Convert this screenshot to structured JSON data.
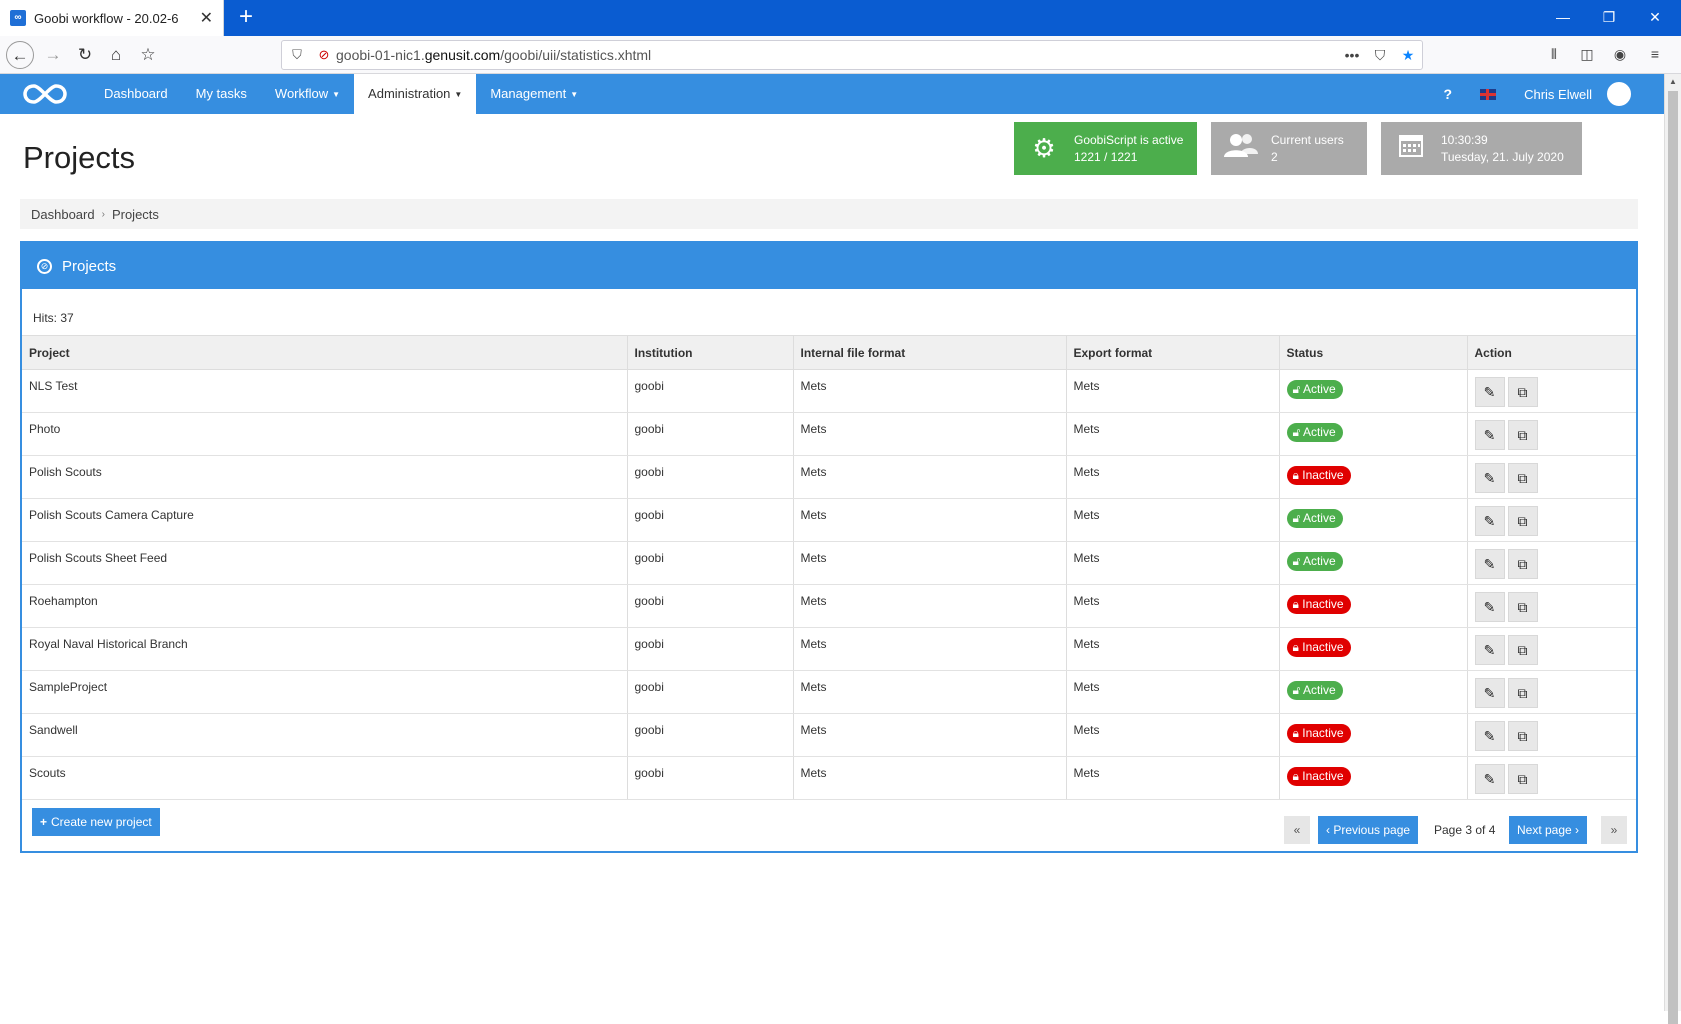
{
  "browser": {
    "tab_title": "Goobi workflow - 20.02-6",
    "url_prefix": "goobi-01-nic1.",
    "url_domain": "genusit.com",
    "url_path": "/goobi/uii/statistics.xhtml"
  },
  "nav": {
    "items": [
      {
        "label": "Dashboard",
        "dropdown": false
      },
      {
        "label": "My tasks",
        "dropdown": false
      },
      {
        "label": "Workflow",
        "dropdown": true
      },
      {
        "label": "Administration",
        "dropdown": true
      },
      {
        "label": "Management",
        "dropdown": true
      }
    ],
    "active": "Administration",
    "help": "?",
    "user": "Chris Elwell"
  },
  "header": {
    "title": "Projects",
    "goobiscript": {
      "line1": "GoobiScript is active",
      "line2": "1221 / 1221"
    },
    "users": {
      "line1": "Current users",
      "line2": "2"
    },
    "datetime": {
      "line1": "10:30:39",
      "line2": "Tuesday, 21. July 2020"
    }
  },
  "breadcrumb": [
    "Dashboard",
    "Projects"
  ],
  "box": {
    "title": "Projects",
    "hits": "Hits: 37",
    "columns": [
      "Project",
      "Institution",
      "Internal file format",
      "Export format",
      "Status",
      "Action"
    ],
    "rows": [
      {
        "project": "NLS Test",
        "institution": "goobi",
        "internal": "Mets",
        "export": "Mets",
        "status": "Active"
      },
      {
        "project": "Photo",
        "institution": "goobi",
        "internal": "Mets",
        "export": "Mets",
        "status": "Active"
      },
      {
        "project": "Polish Scouts",
        "institution": "goobi",
        "internal": "Mets",
        "export": "Mets",
        "status": "Inactive"
      },
      {
        "project": "Polish Scouts Camera Capture",
        "institution": "goobi",
        "internal": "Mets",
        "export": "Mets",
        "status": "Active"
      },
      {
        "project": "Polish Scouts Sheet Feed",
        "institution": "goobi",
        "internal": "Mets",
        "export": "Mets",
        "status": "Active"
      },
      {
        "project": "Roehampton",
        "institution": "goobi",
        "internal": "Mets",
        "export": "Mets",
        "status": "Inactive"
      },
      {
        "project": "Royal Naval Historical Branch",
        "institution": "goobi",
        "internal": "Mets",
        "export": "Mets",
        "status": "Inactive"
      },
      {
        "project": "SampleProject",
        "institution": "goobi",
        "internal": "Mets",
        "export": "Mets",
        "status": "Active"
      },
      {
        "project": "Sandwell",
        "institution": "goobi",
        "internal": "Mets",
        "export": "Mets",
        "status": "Inactive"
      },
      {
        "project": "Scouts",
        "institution": "goobi",
        "internal": "Mets",
        "export": "Mets",
        "status": "Inactive"
      }
    ],
    "create_label": "Create new project",
    "pagination": {
      "prev_label": "Previous page",
      "next_label": "Next page",
      "page_text": "Page 3 of 4"
    }
  },
  "colors": {
    "brand": "#368ee0",
    "active": "#4cae4c",
    "inactive": "#e00000"
  }
}
